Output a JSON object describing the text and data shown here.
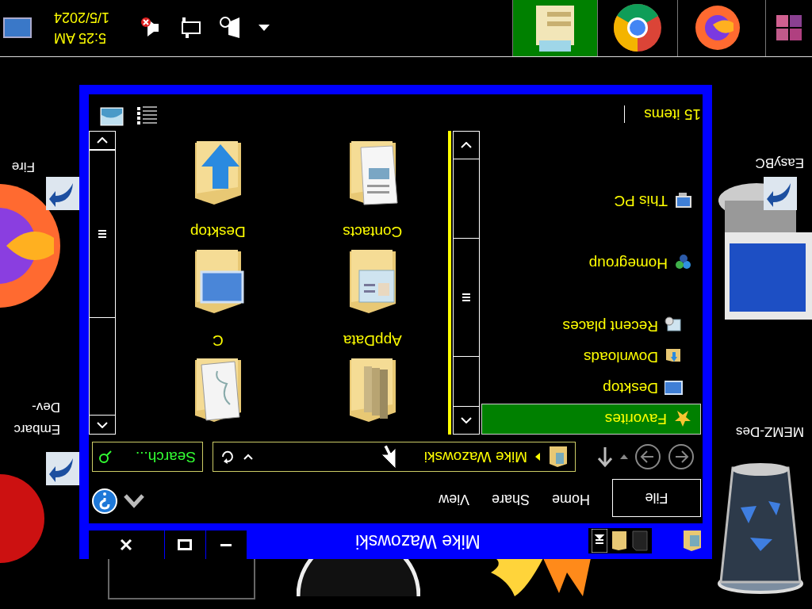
{
  "desktop_icons": [
    {
      "kind": "recycle_bin",
      "label_lines": [
        "MEMZ-Des"
      ],
      "shortcut": false
    },
    {
      "kind": "easybcd",
      "label_lines": [
        "EasyBC"
      ],
      "shortcut": true
    },
    {
      "kind": "devcpp",
      "label_lines": [
        "Embarc",
        "Dev-"
      ],
      "shortcut": true
    },
    {
      "kind": "firefox",
      "label_lines": [
        "Fire"
      ],
      "shortcut": true
    },
    {
      "kind": "flame"
    },
    {
      "kind": "disc"
    },
    {
      "kind": "frame"
    }
  ],
  "window": {
    "title": "Mike Wazowski",
    "ribbon": [
      {
        "kind": "file",
        "label": "File"
      },
      {
        "kind": "tab",
        "label": "Home"
      },
      {
        "kind": "tab",
        "label": "Share"
      },
      {
        "kind": "tab",
        "label": "View"
      }
    ],
    "address": {
      "location": "Mike Wazowski"
    },
    "search": {
      "placeholder": "Search..."
    },
    "nav": [
      {
        "kind": "star",
        "label": "Favorites",
        "selected": true,
        "children": [
          {
            "kind": "desktop",
            "label": "Desktop",
            "selected": false
          },
          {
            "kind": "downloads",
            "label": "Downloads",
            "selected": false
          },
          {
            "kind": "recent",
            "label": "Recent places",
            "selected": false
          }
        ]
      },
      {
        "kind": "homegroup",
        "label": "Homegroup",
        "selected": false
      },
      {
        "kind": "pc",
        "label": "This PC",
        "selected": false
      }
    ],
    "folders": [
      {
        "kind": "files",
        "label": "AppData"
      },
      {
        "kind": "drive",
        "label": "C"
      },
      {
        "kind": "contacts",
        "label": "Contacts"
      },
      {
        "kind": "desktop",
        "label": "Desktop"
      },
      {
        "kind": "documents"
      },
      {
        "kind": "downloads"
      }
    ],
    "status_bar": {
      "item_count": "15 items"
    }
  },
  "taskbar": {
    "apps": [
      {
        "kind": "start",
        "selected": false
      },
      {
        "kind": "firefox",
        "selected": false
      },
      {
        "kind": "chrome",
        "selected": false
      },
      {
        "kind": "explorer",
        "selected": true
      }
    ],
    "tray": {
      "time": "5:25 AM",
      "date": "1/5/2024"
    }
  }
}
